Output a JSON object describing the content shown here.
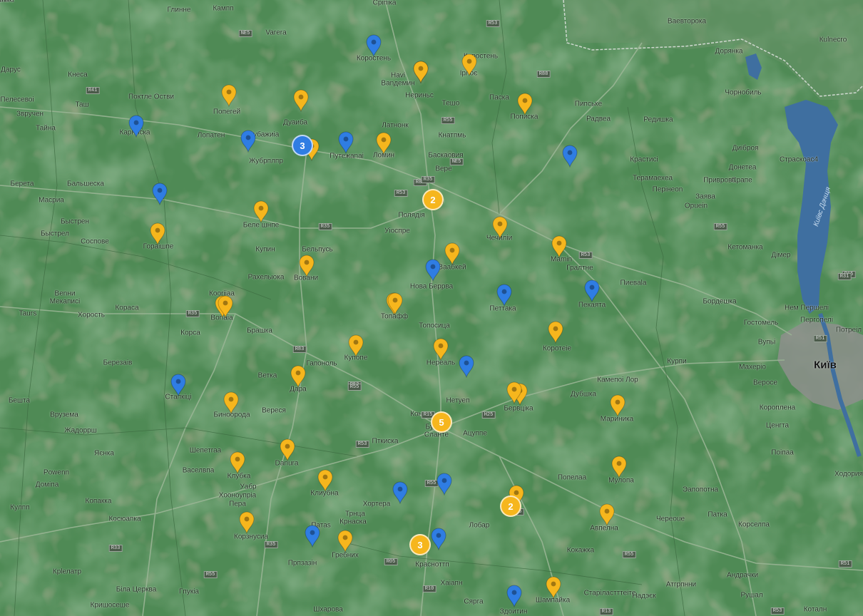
{
  "map": {
    "colors": {
      "land": "#4f8a55",
      "water": "#3f6fa0",
      "urban": "#8d8f8c",
      "road": "#8fb08a",
      "pin_yellow": "#f6b61d",
      "pin_blue": "#2f7de3"
    },
    "water_label": "Київс Дачщя",
    "city_label": "Київ",
    "places": [
      "Глинне",
      "Кампп",
      "Vaгеra",
      "Сріпіка",
      "Ваевторока",
      "Кulnecro",
      "Дарус",
      "Кнеса",
      "Коростень",
      "Коростень",
      "Дорянка",
      "Пелесевоі",
      "Havi",
      "Ваnдемин",
      "Ірлоє",
      "Поктле Остви",
      "Таш",
      "Нериньс",
      "Тешо",
      "Паска",
      "Чорнобиль",
      "Звручен",
      "Попегей",
      "Пипське",
      "Пописка",
      "Радвеа",
      "Редишка",
      "Тайна",
      "Дуаиба",
      "Латнонк",
      "Карнискa",
      "Лопатен",
      "Мубажиіа",
      "Жубрплпр",
      "Путежаnaі",
      "Ломин",
      "Кнатпмь",
      "Баскаовия",
      "Вере",
      "Диіброя",
      "Страскоас4",
      "Донетеа",
      "Крастисі",
      "Срапе",
      "Берета",
      "Бальшеска",
      "Терамаехеа",
      "Приврова",
      "Масриа",
      "Пеpінеоn",
      "Заява",
      "Орuеіn",
      "Кпаим",
      "Полядія",
      "Беле шнпе",
      "Быстрен",
      "Гораішпе",
      "Быстрел",
      "Сосповe",
      "Уіоспре",
      "Чечиліи",
      "Купин",
      "Бельпусь",
      "Маmin",
      "Гралтне",
      "Кетоманка",
      "Дімер",
      "Ваабкей",
      "Рахелыока",
      "Вовани",
      "Нова Беррва",
      "Пиеваla",
      "Веnни",
      "Мекаписі",
      "Кооrііaa",
      "Петтака",
      "Пекаята",
      "Бордешка",
      "Tauгs",
      "Хорость",
      "Кораса",
      "Bonaіа",
      "Топафф",
      "Нем Першелі",
      "Корса",
      "Брашка",
      "Топосица",
      "Коротеіе",
      "Гостомель",
      "Пергопелі",
      "Потреіл",
      "Купопе",
      "Нереаль",
      "Вупьі",
      "Гапоноль",
      "Березаів",
      "Курпи",
      "Махеріо",
      "Ветка",
      "Дара",
      "Камепоі Лор",
      "Бешта",
      "Стапкіці",
      "Нетуеп",
      "Дубшка",
      "Вероce",
      "Конара",
      "Биноорода",
      "Вереся",
      "Бервціка",
      "Мариника",
      "Короплена",
      "Вруземa",
      "Бурка",
      "Сланте",
      "Жадоррш",
      "Ацуппе",
      "Ценгта",
      "Яєнка",
      "Пткиска",
      "Шепетгаа",
      "Danura",
      "Поіпаа",
      "Powenn",
      "Васелвпа",
      "Клубка",
      "Попелаа",
      "Мулопа",
      "Ходория",
      "Доміпа",
      "Уабр",
      "Клиубна",
      "Эапопотна",
      "Кулпп",
      "Копакка",
      "Хооноупріа",
      "Пера",
      "Хортера",
      "Патка",
      "Крнаска",
      "Косюапка",
      "Корзнусиа",
      "Патаs",
      "Трнца",
      "Лобар",
      "Авпелна",
      "Корселпа",
      "Череоuе",
      "Прпзазін",
      "Гребних",
      "Кокажка",
      "Красноттп",
      "Крlелатр",
      "Андрачки",
      "Хаіапн",
      "Атгрпнни",
      "Біла Церква",
      "Гпукіа",
      "Шампайка",
      "Старіластттеіте",
      "Надэєк",
      "Рушал",
      "Кришосеше",
      "Сярга",
      "Шхaрова",
      "Здоитин",
      "Коталн",
      "Уаіта",
      "Рузапма",
      "Рохсітте"
    ],
    "road_shields": [
      "R35",
      "NE5",
      "R88",
      "R53",
      "R55",
      "NE5",
      "R53",
      "R88",
      "R35",
      "R55",
      "R53",
      "R15",
      "R35",
      "R83",
      "R53",
      "R15",
      "H25",
      "R53",
      "R55",
      "E55",
      "R55",
      "R10",
      "R05",
      "R35",
      "R33",
      "R55",
      "R51",
      "R53",
      "R13",
      "R51",
      "R31",
      "R55",
      "R35",
      "R41"
    ],
    "clusters": [
      {
        "count": "3",
        "color": "blue"
      },
      {
        "count": "2",
        "color": "yellow"
      },
      {
        "count": "5",
        "color": "yellow"
      },
      {
        "count": "2",
        "color": "yellow"
      },
      {
        "count": "3",
        "color": "yellow"
      }
    ],
    "yellow_marker_count": 35,
    "blue_marker_count": 16
  }
}
